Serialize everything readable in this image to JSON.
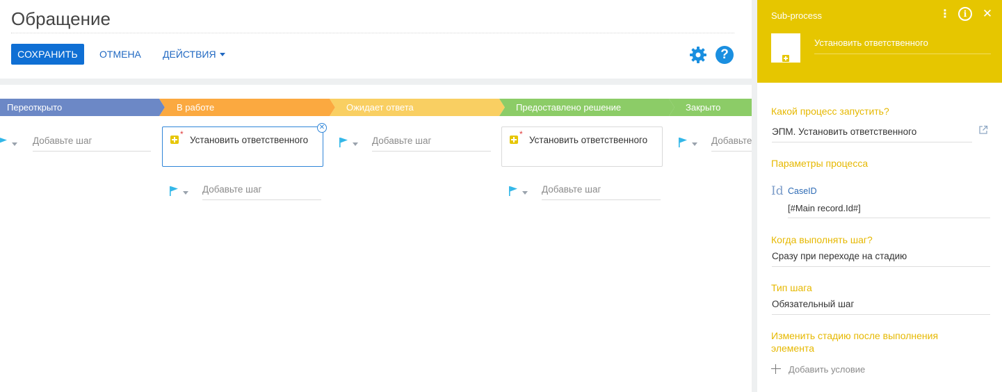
{
  "header": {
    "title": "Обращение",
    "save_label": "СОХРАНИТЬ",
    "cancel_label": "ОТМЕНА",
    "actions_label": "ДЕЙСТВИЯ",
    "help_symbol": "?"
  },
  "stages": [
    {
      "label": "Переоткрыто",
      "color": "#6c88c6"
    },
    {
      "label": "В работе",
      "color": "#fba940"
    },
    {
      "label": "Ожидает ответа",
      "color": "#f9cf62"
    },
    {
      "label": "Предоставлено решение",
      "color": "#8ccc67"
    },
    {
      "label": "Закрыто",
      "color": "#8ccc67"
    }
  ],
  "steps": {
    "add_step_label": "Добавьте шаг",
    "card1_label": "Установить ответственного",
    "card2_label": "Установить ответственного",
    "required_mark": "*",
    "flag_color": "#33b7e8"
  },
  "panel": {
    "title": "Sub-process",
    "element_name": "Установить ответственного",
    "process_label": "Какой процесс запустить?",
    "process_value": "ЭПМ. Установить ответственного",
    "params_label": "Параметры процесса",
    "param_icon": "Id",
    "param_name": "CaseID",
    "param_value": "[#Main record.Id#]",
    "when_label": "Когда выполнять шаг?",
    "when_value": "Сразу при переходе на стадию",
    "type_label": "Тип шага",
    "type_value": "Обязательный шаг",
    "change_stage_label": "Изменить стадию после выполнения элемента",
    "add_condition_label": "Добавить условие",
    "accent_color": "#e6c600"
  }
}
